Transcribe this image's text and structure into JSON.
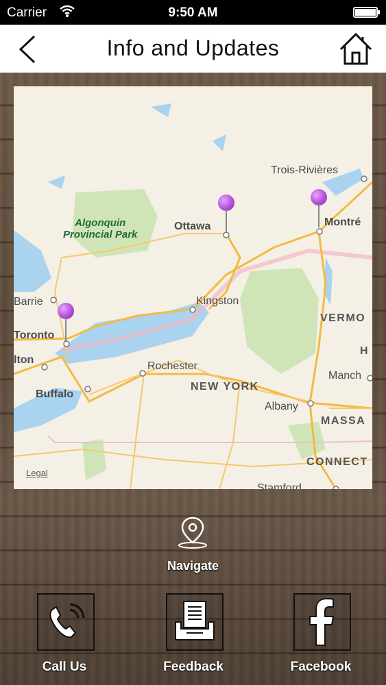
{
  "status_bar": {
    "carrier": "Carrier",
    "time": "9:50 AM"
  },
  "nav": {
    "title": "Info and Updates",
    "back_icon": "chevron-left-icon",
    "home_icon": "home-icon"
  },
  "map": {
    "legal": "Legal",
    "park": "Algonquin\nProvincial Park",
    "cities": [
      "Trois-Rivières",
      "Ottawa",
      "Montré",
      "Kingston",
      "Barrie",
      "Toronto",
      "lton",
      "Rochester",
      "Buffalo",
      "Albany",
      "Manch",
      "Stamford"
    ],
    "regions": [
      "NEW YORK",
      "VERMO",
      "H",
      "MASSA",
      "CONNECT"
    ],
    "pins": 3
  },
  "navigate": {
    "label": "Navigate",
    "icon": "map-pin-icon"
  },
  "buttons": [
    {
      "label": "Call Us",
      "icon": "phone-icon"
    },
    {
      "label": "Feedback",
      "icon": "inbox-document-icon"
    },
    {
      "label": "Facebook",
      "icon": "facebook-icon"
    }
  ]
}
